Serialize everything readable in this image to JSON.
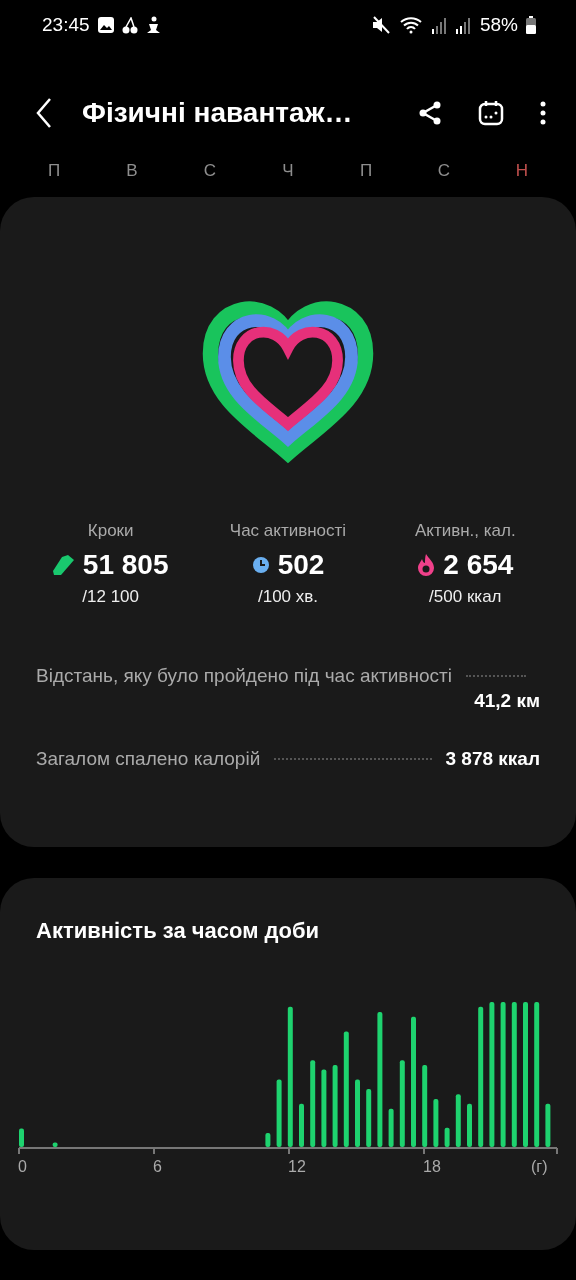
{
  "status_bar": {
    "time": "23:45",
    "battery": "58%"
  },
  "header": {
    "title": "Фізичні навантаж…"
  },
  "weekdays": [
    {
      "label": "П",
      "color": "#8e8e8e"
    },
    {
      "label": "В",
      "color": "#8e8e8e"
    },
    {
      "label": "С",
      "color": "#8e8e8e"
    },
    {
      "label": "Ч",
      "color": "#8e8e8e"
    },
    {
      "label": "П",
      "color": "#8e8e8e"
    },
    {
      "label": "С",
      "color": "#8e8e8e"
    },
    {
      "label": "Н",
      "color": "#c0504d"
    }
  ],
  "summary": {
    "stats": [
      {
        "kind": "steps",
        "label": "Кроки",
        "value": "51 805",
        "goal": "/12 100"
      },
      {
        "kind": "time",
        "label": "Час активності",
        "value": "502",
        "goal": "/100 хв."
      },
      {
        "kind": "calories",
        "label": "Активн., кал.",
        "value": "2 654",
        "goal": "/500 ккал"
      }
    ],
    "details": [
      {
        "label": "Відстань, яку було пройдено під час активності",
        "value": "41,2 км"
      },
      {
        "label": "Загалом спалено калорій",
        "value": "3 878 ккал"
      }
    ]
  },
  "activity": {
    "title": "Активність за часом доби",
    "axis_labels": [
      "0",
      "6",
      "12",
      "18",
      "(г)"
    ]
  }
}
